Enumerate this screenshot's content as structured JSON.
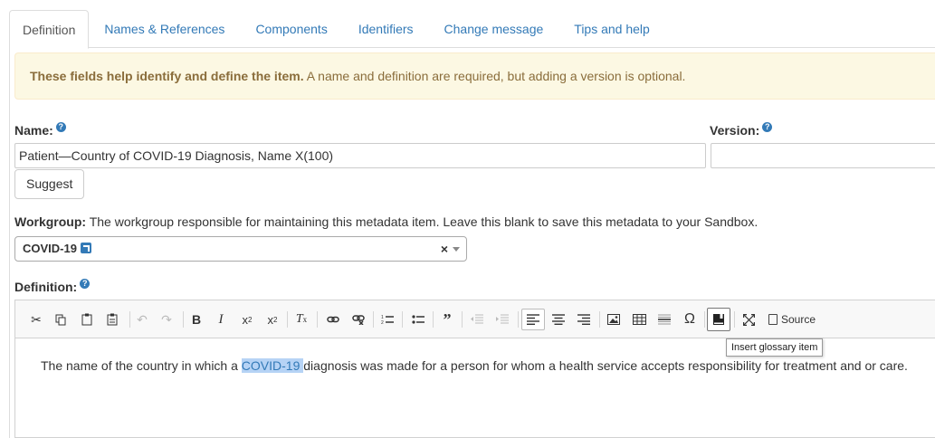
{
  "tabs": [
    {
      "label": "Definition",
      "active": true
    },
    {
      "label": "Names & References"
    },
    {
      "label": "Components"
    },
    {
      "label": "Identifiers"
    },
    {
      "label": "Change message"
    },
    {
      "label": "Tips and help"
    }
  ],
  "alert": {
    "bold": "These fields help identify and define the item.",
    "rest": " A name and definition are required, but adding a version is optional."
  },
  "name_field": {
    "label": "Name:",
    "value": "Patient—Country of COVID-19 Diagnosis, Name X(100)",
    "help_icon": "question-circle-icon"
  },
  "version_field": {
    "label": "Version:",
    "value": "",
    "help_icon": "question-circle-icon"
  },
  "suggest_button": "Suggest",
  "workgroup": {
    "label": "Workgroup:",
    "description": " The workgroup responsible for maintaining this metadata item. Leave this blank to save this metadata to your Sandbox.",
    "selected": "COVID-19",
    "clear": "×"
  },
  "definition": {
    "label": "Definition:",
    "text_before": "The name of the country in which a ",
    "text_highlight": "COVID-19 ",
    "text_after": "diagnosis was made for a person for whom a health service accepts responsibility for treatment and or care."
  },
  "toolbar": {
    "source_label": "Source",
    "tooltip": "Insert glossary item",
    "icons": [
      "cut-icon",
      "copy-icon",
      "paste-icon",
      "paste-text-icon",
      "undo-icon",
      "redo-icon",
      "bold-icon",
      "italic-icon",
      "subscript-icon",
      "superscript-icon",
      "remove-format-icon",
      "link-icon",
      "unlink-icon",
      "numbered-list-icon",
      "bulleted-list-icon",
      "blockquote-icon",
      "outdent-icon",
      "indent-icon",
      "align-left-icon",
      "align-center-icon",
      "align-right-icon",
      "image-icon",
      "table-icon",
      "horizontal-line-icon",
      "special-char-icon",
      "glossary-icon",
      "maximize-icon",
      "source-icon"
    ]
  }
}
